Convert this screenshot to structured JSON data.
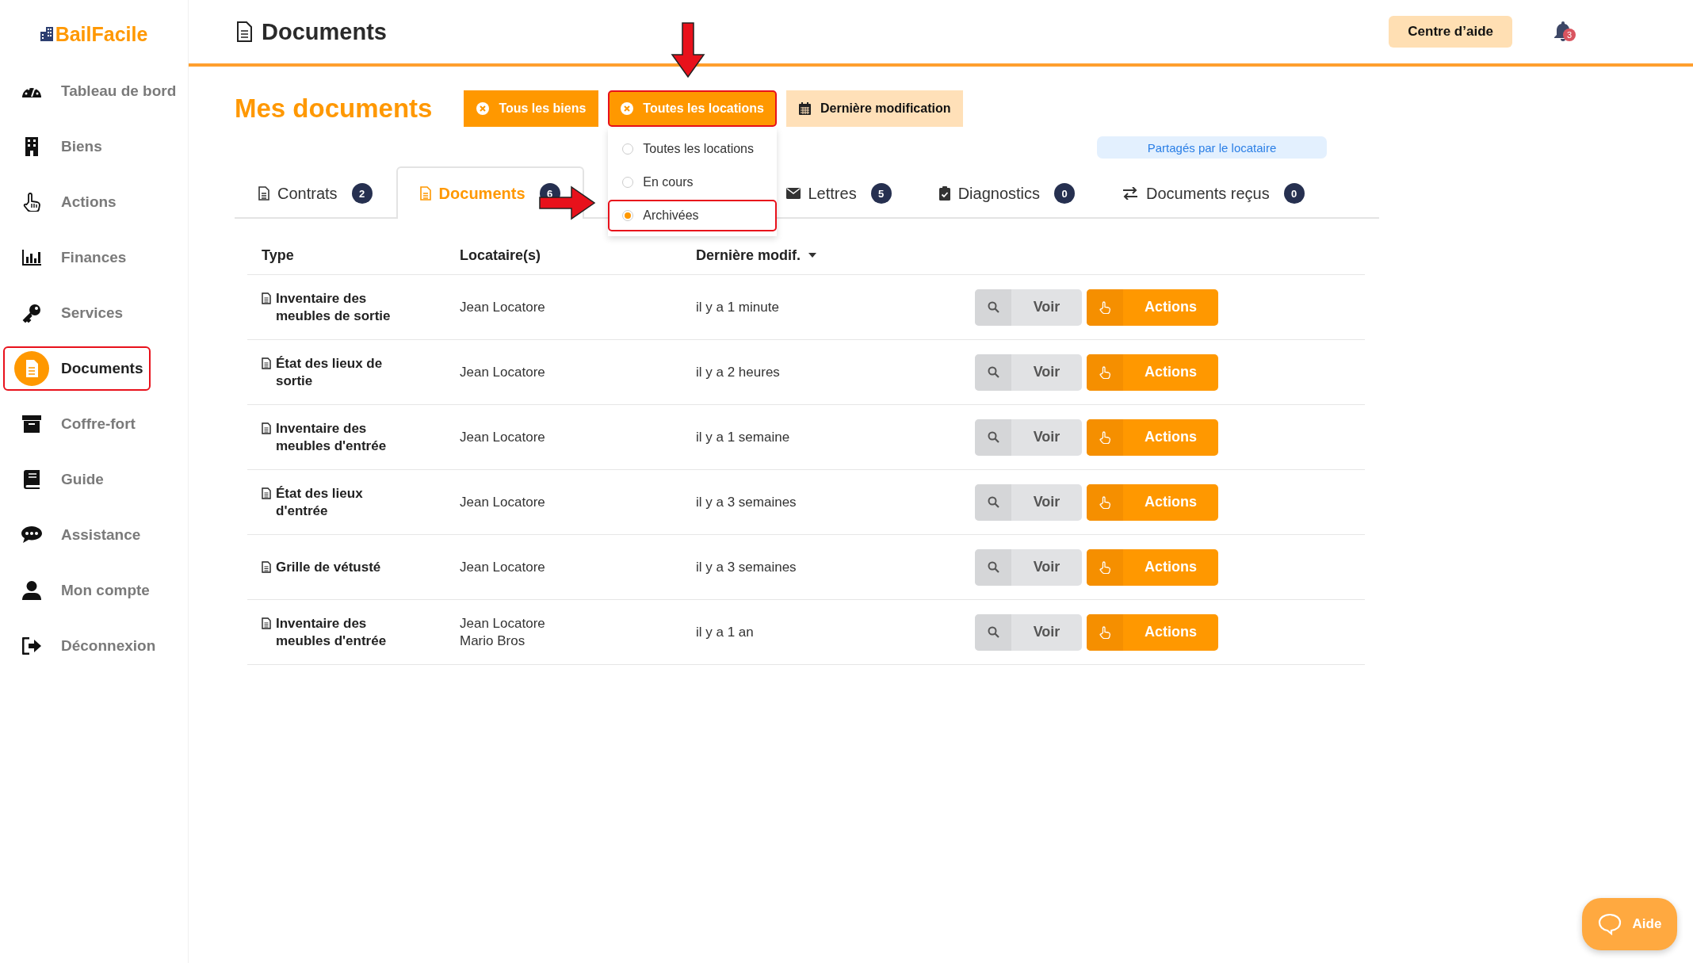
{
  "brand": {
    "name": "BailFacile"
  },
  "sidebar": {
    "items": [
      {
        "label": "Tableau de bord",
        "kind": "dashboard",
        "selected": false,
        "highlighted": false
      },
      {
        "label": "Biens",
        "kind": "building",
        "selected": false,
        "highlighted": false
      },
      {
        "label": "Actions",
        "kind": "hand",
        "selected": false,
        "highlighted": false
      },
      {
        "label": "Finances",
        "kind": "chart",
        "selected": false,
        "highlighted": false
      },
      {
        "label": "Services",
        "kind": "key",
        "selected": false,
        "highlighted": false
      },
      {
        "label": "Documents",
        "kind": "file",
        "selected": true,
        "highlighted": true
      },
      {
        "label": "Coffre-fort",
        "kind": "archive",
        "selected": false,
        "highlighted": false
      },
      {
        "label": "Guide",
        "kind": "book",
        "selected": false,
        "highlighted": false
      },
      {
        "label": "Assistance",
        "kind": "chat",
        "selected": false,
        "highlighted": false
      },
      {
        "label": "Mon compte",
        "kind": "user",
        "selected": false,
        "highlighted": false
      },
      {
        "label": "Déconnexion",
        "kind": "logout",
        "selected": false,
        "highlighted": false
      }
    ]
  },
  "header": {
    "title": "Documents",
    "help_button": "Centre d’aide",
    "notification_count": "3"
  },
  "page_title": "Mes documents",
  "filters": [
    {
      "label": "Tous les biens",
      "kind": "clear",
      "highlighted": false
    },
    {
      "label": "Toutes les locations",
      "kind": "clear",
      "highlighted": true
    },
    {
      "label": "Dernière modification",
      "kind": "sort",
      "highlighted": false
    }
  ],
  "dropdown": {
    "options": [
      {
        "label": "Toutes les locations",
        "selected": false,
        "highlighted": false
      },
      {
        "label": "En cours",
        "selected": false,
        "highlighted": false
      },
      {
        "label": "Archivées",
        "selected": true,
        "highlighted": true
      }
    ]
  },
  "shared_pill": "Partagés par le locataire",
  "tabs": [
    {
      "label": "Contrats",
      "count": "2",
      "kind": "contract",
      "selected": false
    },
    {
      "label": "Documents",
      "count": "6",
      "kind": "file",
      "selected": true
    },
    {
      "label": "Lettres",
      "count": "5",
      "kind": "letter",
      "selected": false
    },
    {
      "label": "Diagnostics",
      "count": "0",
      "kind": "clipboard",
      "selected": false
    },
    {
      "label": "Documents reçus",
      "count": "0",
      "kind": "exchange",
      "selected": false
    }
  ],
  "table": {
    "columns": [
      "Type",
      "Locataire(s)",
      "Dernière modif."
    ],
    "rows": [
      {
        "type": "Inventaire des meubles de sortie",
        "tenants": [
          "Jean Locatore"
        ],
        "modified": "il y a 1 minute",
        "view": "Voir",
        "actions": "Actions"
      },
      {
        "type": "État des lieux de sortie",
        "tenants": [
          "Jean Locatore"
        ],
        "modified": "il y a 2 heures",
        "view": "Voir",
        "actions": "Actions"
      },
      {
        "type": "Inventaire des meubles d'entrée",
        "tenants": [
          "Jean Locatore"
        ],
        "modified": "il y a 1 semaine",
        "view": "Voir",
        "actions": "Actions"
      },
      {
        "type": "État des lieux d'entrée",
        "tenants": [
          "Jean Locatore"
        ],
        "modified": "il y a 3 semaines",
        "view": "Voir",
        "actions": "Actions"
      },
      {
        "type": "Grille de vétusté",
        "tenants": [
          "Jean Locatore"
        ],
        "modified": "il y a 3 semaines",
        "view": "Voir",
        "actions": "Actions"
      },
      {
        "type": "Inventaire des meubles d'entrée",
        "tenants": [
          "Jean Locatore",
          "Mario Bros"
        ],
        "modified": "il y a 1 an",
        "view": "Voir",
        "actions": "Actions"
      }
    ]
  },
  "help_fab": "Aide"
}
